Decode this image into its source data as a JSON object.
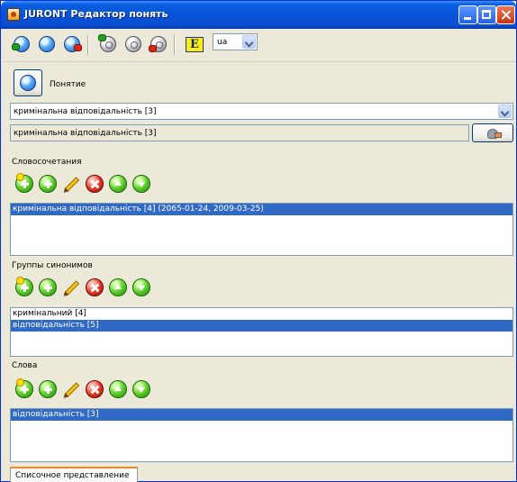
{
  "window": {
    "title": "JURONT Редактор понять"
  },
  "toolbar": {
    "tools": [
      {
        "icon": "concept-add-icon"
      },
      {
        "icon": "concept-view-icon"
      },
      {
        "icon": "concept-delete-icon"
      },
      {
        "icon": "disk-add-icon"
      },
      {
        "icon": "disk-icon"
      },
      {
        "icon": "disk-delete-icon"
      },
      {
        "icon": "english-e-icon"
      }
    ],
    "language": "ua"
  },
  "concept": {
    "label": "Понятие",
    "selected": "кримінальна відповідальність [3]",
    "field_value": "кримінальна відповідальність [3]"
  },
  "sections": {
    "phrases": {
      "label": "Словосочетания",
      "items": [
        "кримінальна відповідальність [4] (2065-01-24, 2009-03-25)"
      ],
      "selected_index": 0
    },
    "synonyms": {
      "label": "Группы синонимов",
      "items": [
        "кримінальний [4]",
        "відповідальність [5]"
      ],
      "selected_index": 1
    },
    "words": {
      "label": "Слова",
      "items": [
        "відповідальність [3]"
      ],
      "selected_index": 0
    }
  },
  "tabs": {
    "list_view": "Списочное представление"
  },
  "colors": {
    "selection": "#316ac5",
    "panel": "#ece9d8",
    "titlebar": "#0653d8"
  }
}
